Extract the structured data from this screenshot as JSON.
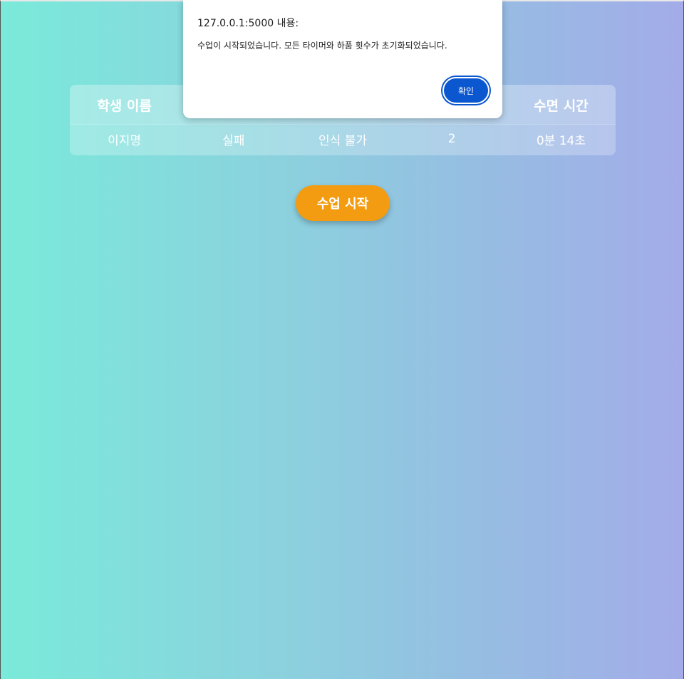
{
  "table": {
    "headers": [
      "학생 이름",
      "",
      "",
      "",
      "수면 시간"
    ],
    "rows": [
      [
        "이지명",
        "실패",
        "인식 불가",
        "2",
        "0분 14초"
      ]
    ]
  },
  "controls": {
    "start_label": "수업 시작"
  },
  "dialog": {
    "title": "127.0.0.1:5000 내용:",
    "message": "수업이 시작되었습니다. 모든 타이머와 하품 횟수가 초기화되었습니다.",
    "ok_label": "확인"
  },
  "colors": {
    "start_button": "#f39c12",
    "dialog_ok": "#0b57d0"
  }
}
